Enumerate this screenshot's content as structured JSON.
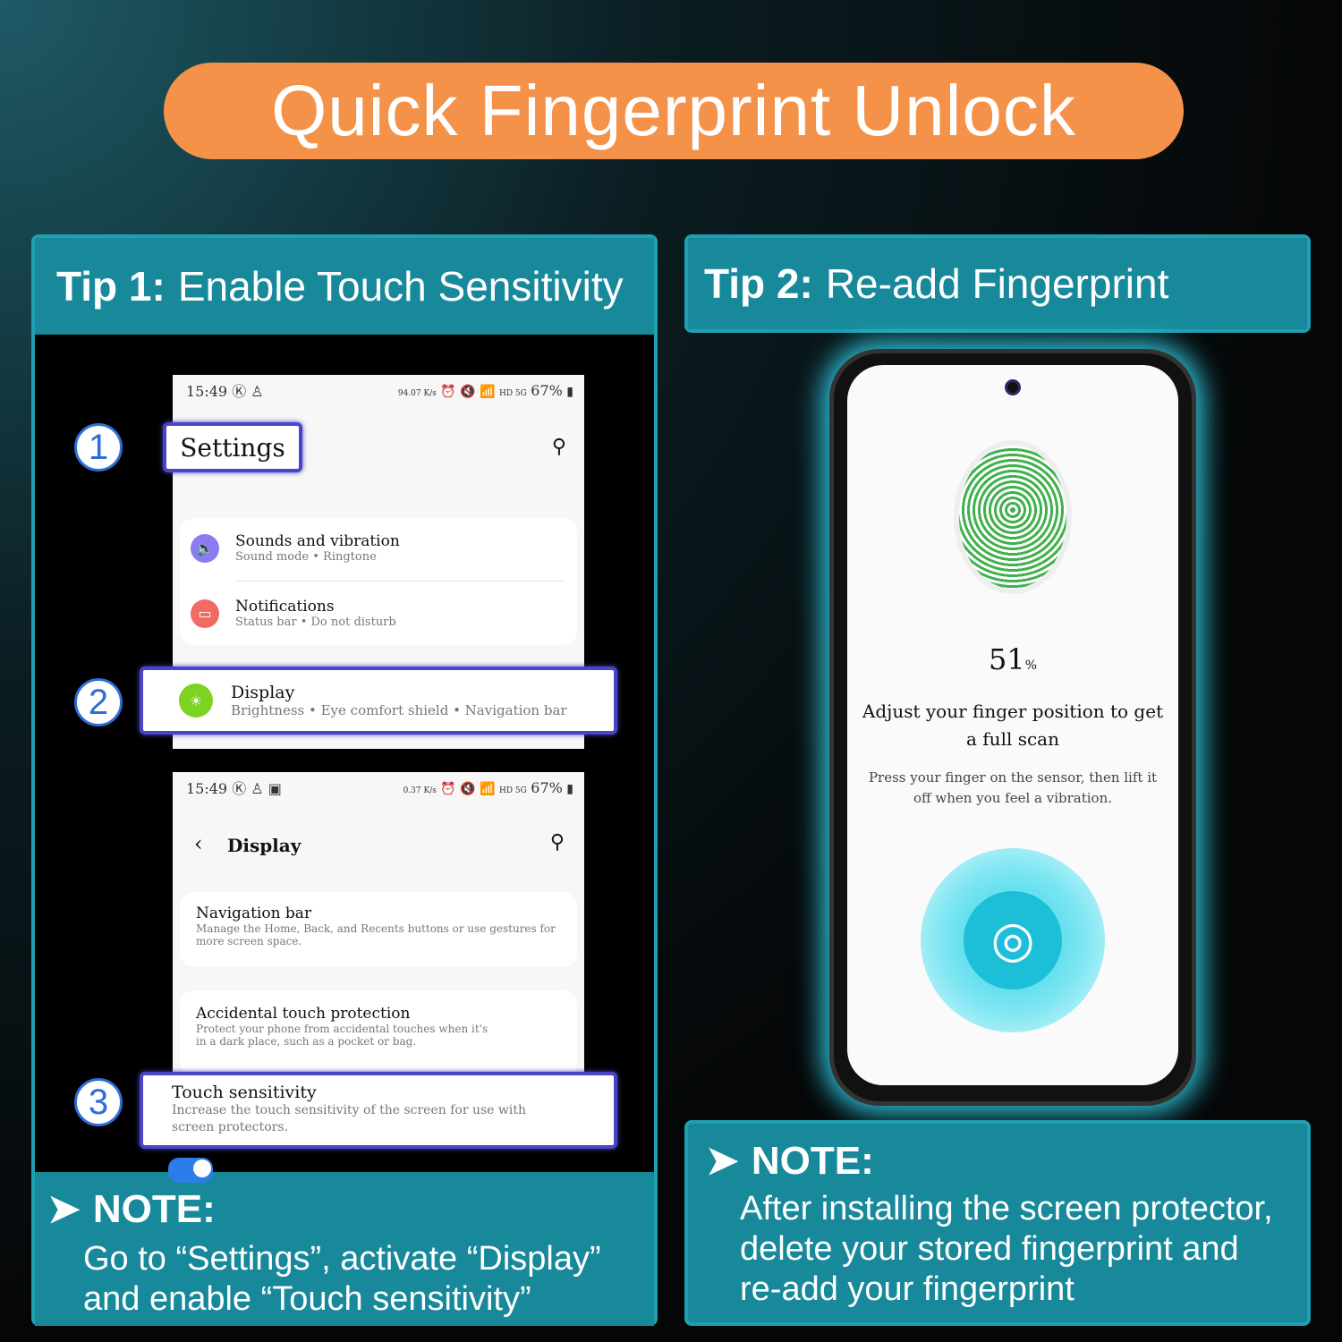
{
  "title": "Quick Fingerprint Unlock",
  "tip1": {
    "label": "Tip 1:",
    "title": "Enable Touch Sensitivity",
    "steps": [
      "1",
      "2",
      "3"
    ],
    "screen1": {
      "time": "15:49",
      "net_speed": "94.07 K/s",
      "battery": "67%",
      "network": "HD 5G",
      "page_title": "Settings",
      "items": [
        {
          "title": "Sounds and vibration",
          "subtitle": "Sound mode  •  Ringtone",
          "icon": "speaker-icon",
          "color": "#8b7cf0"
        },
        {
          "title": "Notifications",
          "subtitle": "Status bar  •  Do not disturb",
          "icon": "notification-icon",
          "color": "#f06b62"
        },
        {
          "title": "Display",
          "subtitle": "Brightness  •  Eye comfort shield  •  Navigation bar",
          "icon": "sun-icon",
          "color": "#7dd321"
        }
      ]
    },
    "screen2": {
      "time": "15:49",
      "net_speed": "0.37 K/s",
      "battery": "67%",
      "network": "HD 5G",
      "page_title": "Display",
      "items": [
        {
          "title": "Navigation bar",
          "subtitle": "Manage the Home, Back, and Recents buttons or use gestures for more screen space."
        },
        {
          "title": "Accidental touch protection",
          "subtitle": "Protect your phone from accidental touches when it's in a dark place, such as a pocket or bag.",
          "toggle": true
        },
        {
          "title": "Touch sensitivity",
          "subtitle": "Increase the touch sensitivity of the screen for use with screen protectors.",
          "toggle": true
        }
      ]
    },
    "note_title": "NOTE:",
    "note_lines": [
      "Go to “Settings”, activate “Display”",
      "and enable “Touch sensitivity”"
    ]
  },
  "tip2": {
    "label": "Tip 2:",
    "title": "Re-add Fingerprint",
    "phone": {
      "progress": "51",
      "progress_unit": "%",
      "heading": "Adjust your finger position to get a full scan",
      "instruction": "Press your finger on the sensor, then lift it off when you feel a vibration."
    },
    "note_title": "NOTE:",
    "note_lines": [
      "After installing the screen protector,",
      "delete your stored fingerprint and",
      "re-add your fingerprint"
    ]
  },
  "colors": {
    "accent": "#f5924a",
    "teal": "#17899a",
    "highlight": "#4a45c8",
    "toggle": "#2b7de9"
  }
}
